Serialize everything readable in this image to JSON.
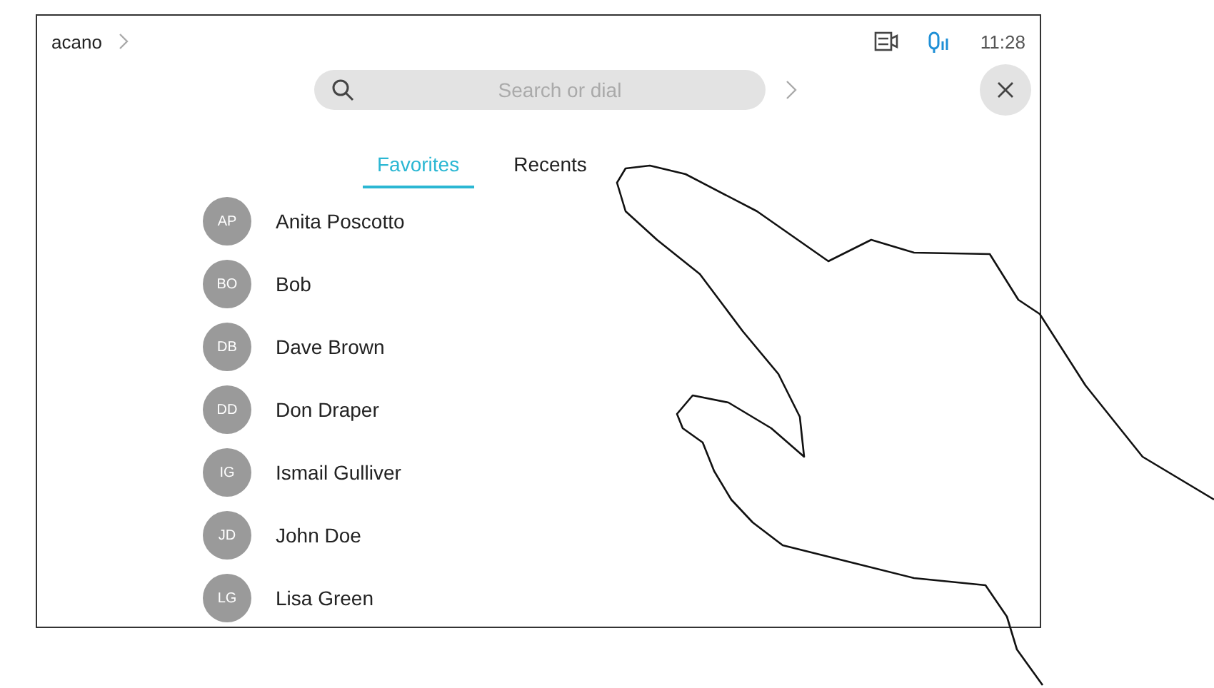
{
  "top_bar": {
    "title": "acano",
    "time": "11:28"
  },
  "search": {
    "placeholder": "Search or dial"
  },
  "tabs": [
    {
      "label": "Favorites",
      "selected": true
    },
    {
      "label": "Recents",
      "selected": false
    }
  ],
  "contacts": [
    {
      "initials": "AP",
      "name": "Anita Poscotto"
    },
    {
      "initials": "BO",
      "name": "Bob"
    },
    {
      "initials": "DB",
      "name": "Dave Brown"
    },
    {
      "initials": "DD",
      "name": "Don Draper"
    },
    {
      "initials": "IG",
      "name": "Ismail Gulliver"
    },
    {
      "initials": "JD",
      "name": "John Doe"
    },
    {
      "initials": "LG",
      "name": "Lisa Green"
    }
  ]
}
